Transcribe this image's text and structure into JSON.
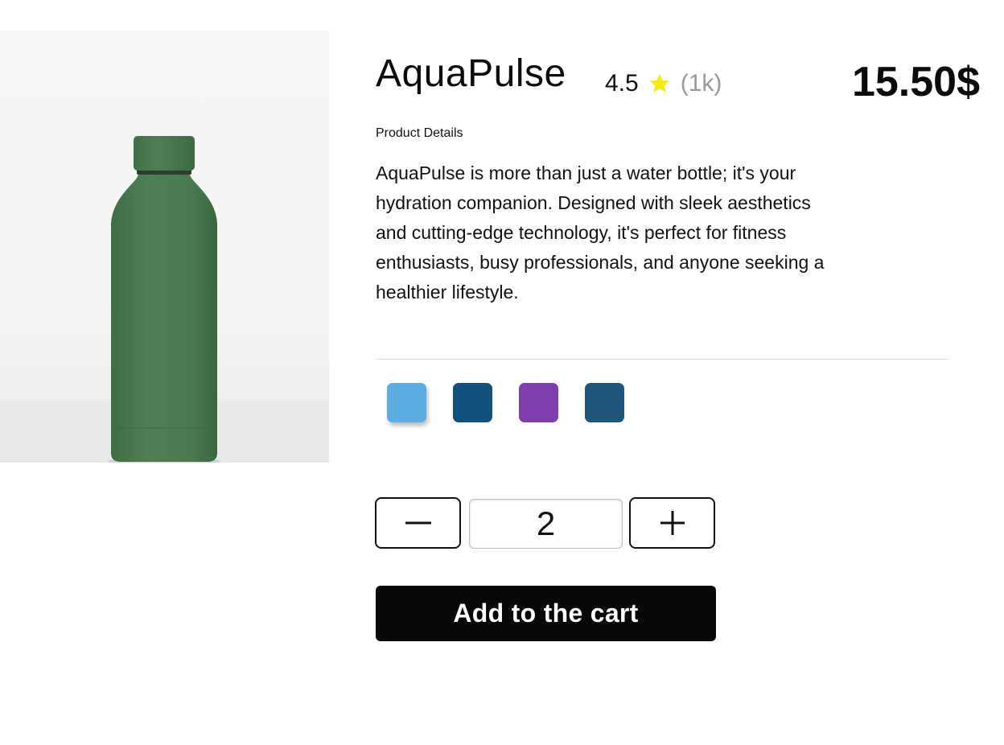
{
  "product": {
    "image_alt": "Green water bottle",
    "title": "AquaPulse",
    "rating": "4.5",
    "rating_icon": "star-icon",
    "rating_count": "(1k)",
    "price": "15.50$",
    "details_label": "Product Details",
    "description": "AquaPulse is more than just a water bottle; it's your hydration companion. Designed with sleek aesthetics and cutting-edge technology, it's perfect for fitness enthusiasts, busy professionals, and anyone seeking a healthier lifestyle."
  },
  "colors": {
    "star": "#f5e90f",
    "bottle": "#4c7d52",
    "swatches": [
      "#5dade2",
      "#11527d",
      "#7d3fad",
      "#1f577a"
    ],
    "selected_swatch": 0
  },
  "quantity": {
    "decrement_icon": "minus-icon",
    "value": "2",
    "increment_icon": "plus-icon"
  },
  "actions": {
    "add_to_cart_label": "Add to the cart"
  }
}
